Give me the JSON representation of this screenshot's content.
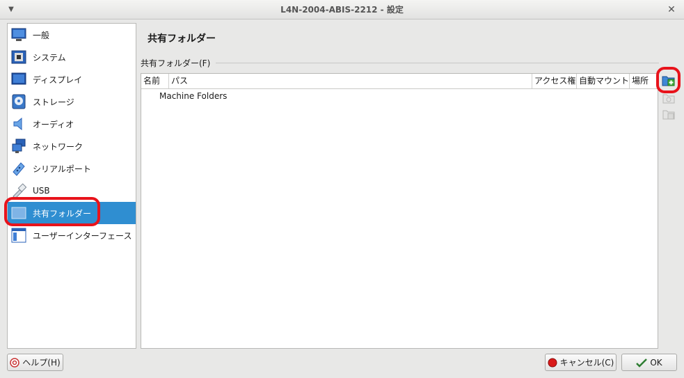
{
  "window": {
    "title": "L4N-2004-ABIS-2212 - 設定"
  },
  "sidebar": {
    "items": [
      {
        "label": "一般",
        "icon": "general-icon"
      },
      {
        "label": "システム",
        "icon": "system-icon"
      },
      {
        "label": "ディスプレイ",
        "icon": "display-icon"
      },
      {
        "label": "ストレージ",
        "icon": "storage-icon"
      },
      {
        "label": "オーディオ",
        "icon": "audio-icon"
      },
      {
        "label": "ネットワーク",
        "icon": "network-icon"
      },
      {
        "label": "シリアルポート",
        "icon": "serial-port-icon"
      },
      {
        "label": "USB",
        "icon": "usb-icon"
      },
      {
        "label": "共有フォルダー",
        "icon": "shared-folder-icon",
        "active": true
      },
      {
        "label": "ユーザーインターフェース",
        "icon": "user-interface-icon"
      }
    ]
  },
  "main": {
    "title": "共有フォルダー",
    "group_label": "共有フォルダー(F)",
    "table": {
      "columns": [
        "名前",
        "パス",
        "アクセス権",
        "自動マウント",
        "場所"
      ],
      "rows": [
        {
          "name": "Machine Folders"
        }
      ]
    }
  },
  "buttons": {
    "help": "ヘルプ(H)",
    "cancel": "キャンセル(C)",
    "ok": "OK"
  },
  "colors": {
    "selection": "#2f8ed1",
    "highlight": "#e8131b"
  }
}
